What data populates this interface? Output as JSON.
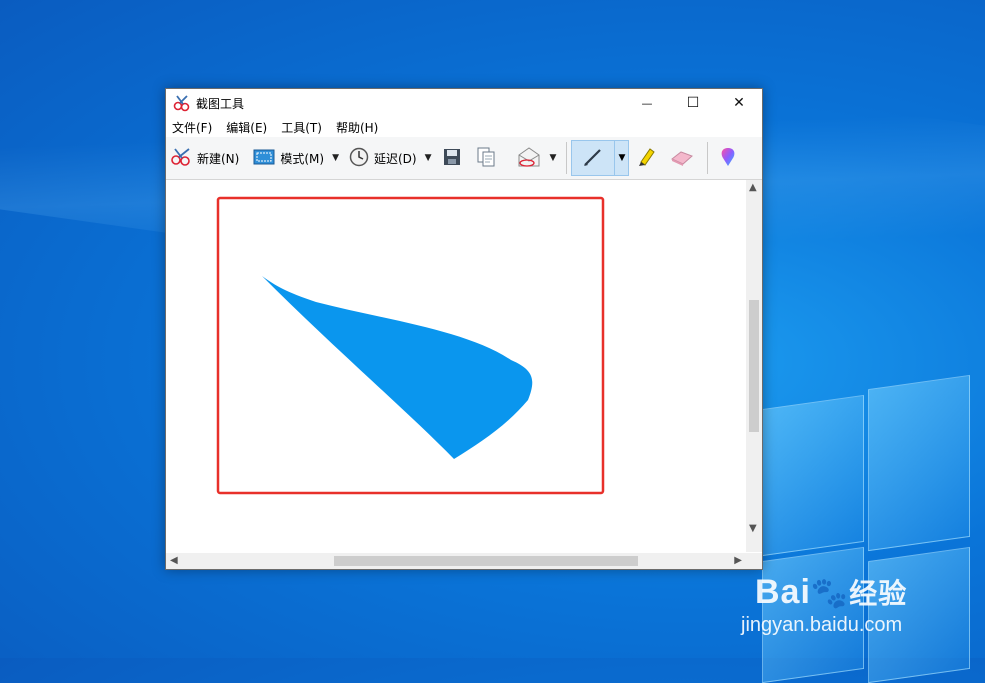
{
  "window": {
    "title": "截图工具",
    "controls": {
      "minimize": "—",
      "maximize": "☐",
      "close": "✕"
    }
  },
  "menu": [
    "文件(F)",
    "编辑(E)",
    "工具(T)",
    "帮助(H)"
  ],
  "toolbar": {
    "new_label": "新建(N)",
    "mode_label": "模式(M)",
    "delay_label": "延迟(D)"
  },
  "colors": {
    "selection_border": "#e8302a",
    "shape_fill": "#0a96ee",
    "pen_active_bg": "#cde4f7"
  },
  "watermark": {
    "brand_a": "Bai",
    "brand_b": "经验",
    "url": "jingyan.baidu.com"
  }
}
